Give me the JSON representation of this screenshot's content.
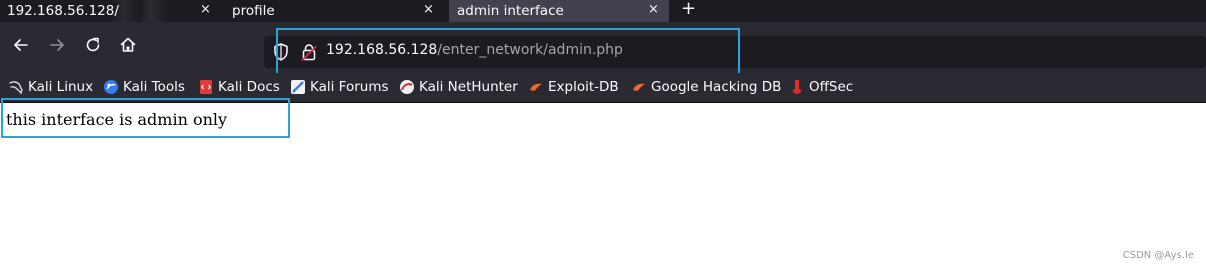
{
  "tabs": [
    {
      "label": "192.168.56.128/",
      "close": "×",
      "active": false
    },
    {
      "label": "profile",
      "close": "×",
      "active": false
    },
    {
      "label": "admin interface",
      "close": "×",
      "active": true
    }
  ],
  "new_tab": "+",
  "nav": {
    "back_icon": "arrow-left-icon",
    "forward_icon": "arrow-right-icon",
    "reload_icon": "reload-icon",
    "home_icon": "home-icon"
  },
  "urlbar": {
    "host": "192.168.56.128",
    "path": "/enter_network/admin.php"
  },
  "bookmarks": [
    {
      "label": "Kali Linux",
      "icon": "kali-dragon-icon"
    },
    {
      "label": "Kali Tools",
      "icon": "kali-tools-icon"
    },
    {
      "label": "Kali Docs",
      "icon": "kali-docs-icon"
    },
    {
      "label": "Kali Forums",
      "icon": "kali-forums-icon"
    },
    {
      "label": "Kali NetHunter",
      "icon": "nethunter-icon"
    },
    {
      "label": "Exploit-DB",
      "icon": "exploit-db-icon"
    },
    {
      "label": "Google Hacking DB",
      "icon": "ghdb-icon"
    },
    {
      "label": "OffSec",
      "icon": "offsec-icon"
    }
  ],
  "page": {
    "message": "this interface is admin only"
  },
  "watermark": "CSDN @Ays.Ie",
  "colors": {
    "tabstrip_bg": "#1c1b22",
    "active_tab_bg": "#42414d",
    "toolbar_bg": "#2b2a33",
    "urlbar_bg": "#1c1b22",
    "highlight_border": "#29a3d8"
  }
}
